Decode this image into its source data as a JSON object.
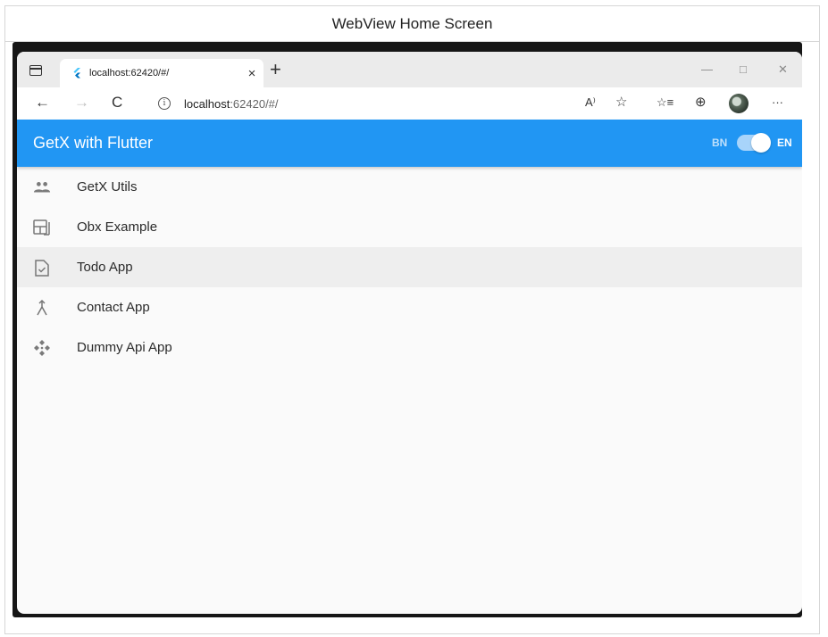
{
  "caption": "WebView Home Screen",
  "browser": {
    "tab_title": "localhost:62420/#/",
    "tab_close": "×",
    "new_tab": "+",
    "window_controls": {
      "minimize": "—",
      "maximize": "□",
      "close": "✕"
    },
    "nav": {
      "back": "←",
      "forward": "→",
      "refresh": "C"
    },
    "address": {
      "host": "localhost",
      "path": ":62420/#/"
    },
    "toolbar_icons": {
      "read_aloud": "A⁾",
      "add_favorite": "☆",
      "favorites": "☆≡",
      "collections": "⊕",
      "more": "···"
    }
  },
  "app": {
    "title": "GetX with Flutter",
    "lang_left": "BN",
    "lang_right": "EN",
    "toggle_on": true,
    "primary_color": "#2196f3",
    "menu": [
      {
        "label": "GetX Utils",
        "icon": "people-icon",
        "highlighted": false
      },
      {
        "label": "Obx Example",
        "icon": "dashboard-icon",
        "highlighted": false
      },
      {
        "label": "Todo App",
        "icon": "task-file-icon",
        "highlighted": true
      },
      {
        "label": "Contact App",
        "icon": "merge-arrow-icon",
        "highlighted": false
      },
      {
        "label": "Dummy Api App",
        "icon": "api-diamond-icon",
        "highlighted": false
      }
    ]
  }
}
